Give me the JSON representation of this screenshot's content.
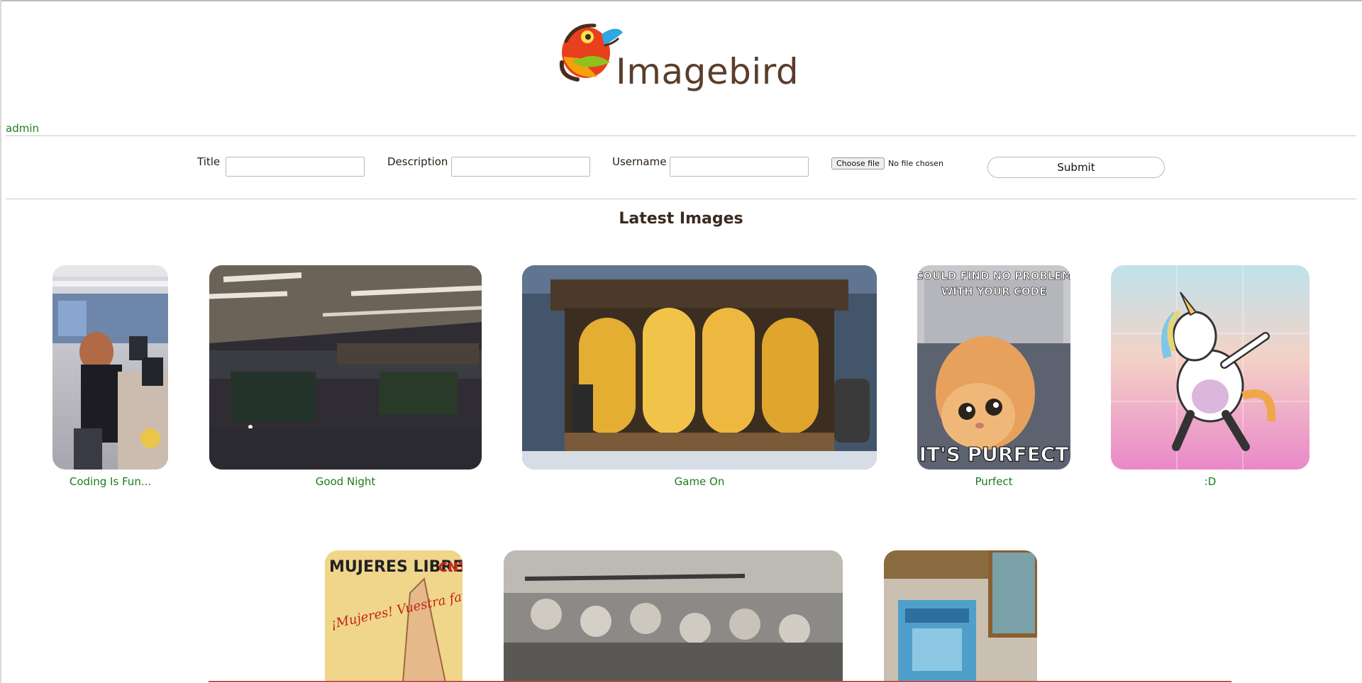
{
  "app": {
    "logo_text": "Imagebird",
    "brand_colors": {
      "accent": "#1c7d1c",
      "text": "#3a2a1f",
      "logo_text": "#5a3e2b"
    }
  },
  "user": {
    "name": "admin"
  },
  "form": {
    "title_label": "Title",
    "description_label": "Description",
    "username_label": "Username",
    "title_value": "",
    "description_value": "",
    "username_value": "",
    "file_button_label": "Choose file",
    "file_status": "No file chosen",
    "submit_label": "Submit"
  },
  "gallery": {
    "heading": "Latest Images",
    "row1": [
      {
        "caption": "Coding Is Fun...",
        "icon": "office-photo"
      },
      {
        "caption": "Good Night",
        "icon": "dark-office-photo"
      },
      {
        "caption": "Game On",
        "icon": "golden-window-illustration"
      },
      {
        "caption": "Purfect",
        "icon": "cat-meme",
        "meme_top": "I COULD FIND NO PROBLEMS WITH YOUR CODE",
        "meme_bottom": "IT'S PURFECT"
      },
      {
        "caption": ":D",
        "icon": "dabbing-unicorn"
      }
    ],
    "row2": [
      {
        "icon": "mujeres-libres-poster",
        "poster_title": "MUJERES LIBRES",
        "poster_tag": "CNT",
        "poster_text": "¡Mujeres! Vuestra familia la constituyen todos los luchadores de"
      },
      {
        "icon": "historic-crowd-photo"
      },
      {
        "icon": "window-poster-photo"
      }
    ]
  }
}
